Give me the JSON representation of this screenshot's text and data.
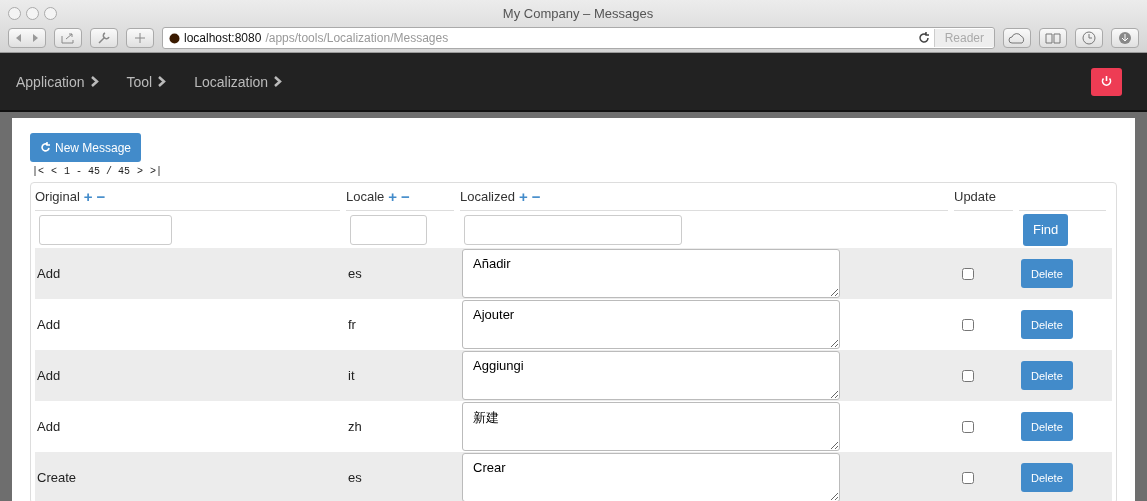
{
  "window": {
    "title": "My Company – Messages"
  },
  "browser": {
    "url_host": "localhost:8080",
    "url_path": "/apps/tools/Localization/Messages",
    "reader": "Reader"
  },
  "breadcrumbs": [
    {
      "label": "Application"
    },
    {
      "label": "Tool"
    },
    {
      "label": "Localization"
    }
  ],
  "new_button": "New Message",
  "pager": [
    "|<",
    "<",
    "1 - 45 / 45",
    ">",
    ">|"
  ],
  "columns": [
    {
      "label": "Original",
      "sort_up": "+",
      "sort_down": "−"
    },
    {
      "label": "Locale",
      "sort_up": "+",
      "sort_down": "−"
    },
    {
      "label": "Localized",
      "sort_up": "+",
      "sort_down": "−"
    },
    {
      "label": "Update"
    }
  ],
  "find_button": "Find",
  "rows": [
    {
      "original": "Add",
      "locale": "es",
      "localized": "Añadir",
      "update": false,
      "delete": "Delete"
    },
    {
      "original": "Add",
      "locale": "fr",
      "localized": "Ajouter",
      "update": false,
      "delete": "Delete"
    },
    {
      "original": "Add",
      "locale": "it",
      "localized": "Aggiungi",
      "update": false,
      "delete": "Delete"
    },
    {
      "original": "Add",
      "locale": "zh",
      "localized": "新建",
      "update": false,
      "delete": "Delete"
    },
    {
      "original": "Create",
      "locale": "es",
      "localized": "Crear",
      "update": false,
      "delete": "Delete"
    }
  ]
}
